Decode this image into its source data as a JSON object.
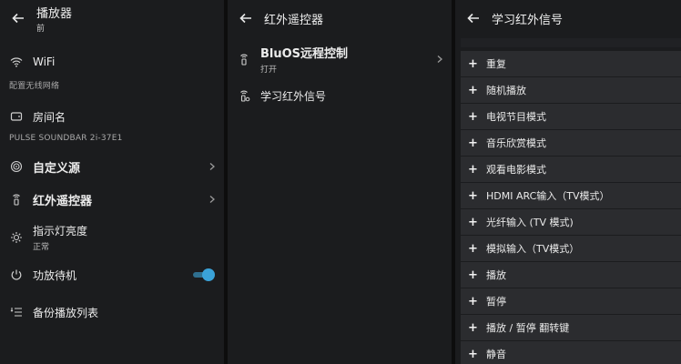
{
  "panel1": {
    "header": {
      "title": "播放器",
      "subtitle": "前"
    },
    "wifi": {
      "label": "WiFi",
      "caption": "配置无线网络"
    },
    "room": {
      "label": "房间名",
      "caption": "PULSE SOUNDBAR 2i-37E1"
    },
    "custom_source": {
      "label": "自定义源"
    },
    "ir_remote": {
      "label": "红外遥控器"
    },
    "led": {
      "label": "指示灯亮度",
      "sub": "正常"
    },
    "standby": {
      "label": "功放待机",
      "enabled": true
    },
    "backup": {
      "label": "备份播放列表"
    }
  },
  "panel2": {
    "header": {
      "title": "红外遥控器"
    },
    "bluos": {
      "label": "BluOS远程控制",
      "sub": "打开"
    },
    "learn": {
      "label": "学习红外信号"
    }
  },
  "panel3": {
    "header": {
      "title": "学习红外信号"
    },
    "items": [
      "重复",
      "随机播放",
      "电视节目模式",
      "音乐欣赏模式",
      "观看电影模式",
      "HDMI ARC输入（TV模式）",
      "光纤输入 (TV 模式)",
      "模拟输入（TV模式）",
      "播放",
      "暂停",
      "播放 / 暂停 翻转键",
      "静音"
    ]
  },
  "colors": {
    "panel_bg": "#1b1c1e",
    "item_bg": "#2b2c2f",
    "accent": "#3aa2d8"
  }
}
